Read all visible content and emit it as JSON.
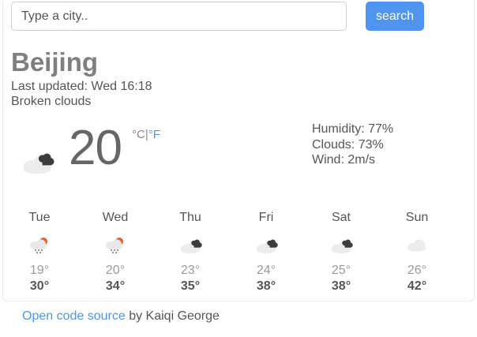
{
  "search": {
    "placeholder": "Type a city..",
    "value": "",
    "button_label": "search"
  },
  "current": {
    "city": "Beijing",
    "last_updated": "Last updated: Wed 16:18",
    "description": "Broken clouds",
    "temperature": "20",
    "unit_c": "°C",
    "unit_separator": "|",
    "unit_f": "°F",
    "humidity": "Humidity: 77%",
    "clouds": "Clouds: 73%",
    "wind": "Wind: 2m/s",
    "icon": "broken-clouds-icon"
  },
  "forecast": [
    {
      "day": "Tue",
      "min": "19°",
      "max": "30°",
      "icon": "rain-icon"
    },
    {
      "day": "Wed",
      "min": "20°",
      "max": "34°",
      "icon": "rain-icon"
    },
    {
      "day": "Thu",
      "min": "23°",
      "max": "35°",
      "icon": "broken-clouds-icon"
    },
    {
      "day": "Fri",
      "min": "24°",
      "max": "38°",
      "icon": "broken-clouds-icon"
    },
    {
      "day": "Sat",
      "min": "25°",
      "max": "38°",
      "icon": "broken-clouds-icon"
    },
    {
      "day": "Sun",
      "min": "26°",
      "max": "42°",
      "icon": "cloud-icon"
    }
  ],
  "footer": {
    "link_text": "Open code source",
    "author_text": " by Kaiqi George"
  },
  "colors": {
    "accent": "#4f95f0",
    "city_gray": "#7f7f7f",
    "min_temp": "#999999"
  }
}
